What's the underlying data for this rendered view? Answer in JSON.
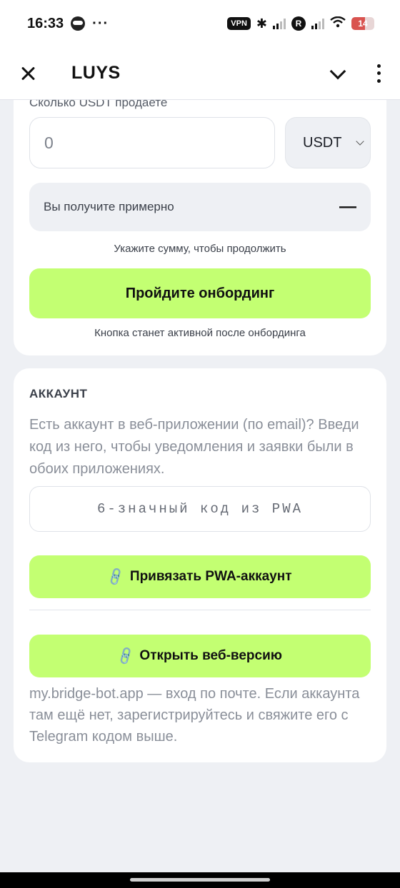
{
  "status_bar": {
    "time": "16:33",
    "more": "···",
    "vpn": "VPN",
    "r_badge": "R",
    "battery": "14"
  },
  "header": {
    "title": "LUYS"
  },
  "sell_card": {
    "label": "Сколько USDT продаете",
    "amount_value": "0",
    "currency": "USDT",
    "receive_label": "Вы получите примерно",
    "receive_value": "—",
    "hint_amount": "Укажите сумму, чтобы продолжить",
    "onboard_button": "Пройдите онбординг",
    "hint_onboard": "Кнопка станет активной после онбординга"
  },
  "account_card": {
    "title": "АККАУНТ",
    "description": "Есть аккаунт в веб-приложении (по email)? Введи код из него, чтобы уведомления и заявки были в обоих приложениях.",
    "code_placeholder": "6-значный код из PWA",
    "link_button": "Привязать PWA-аккаунт",
    "web_button": "Открыть веб-версию",
    "footer": "my.bridge-bot.app — вход по почте. Если аккаунта там ещё нет, зарегистрируйтесь и свяжите его с Telegram кодом выше."
  },
  "colors": {
    "accent": "#c3ff72",
    "background": "#eef0f4",
    "card": "#ffffff"
  },
  "icons": {
    "close": "close-icon",
    "chevron": "chevron-down-icon",
    "more": "more-vertical-icon",
    "link": "link-icon"
  }
}
